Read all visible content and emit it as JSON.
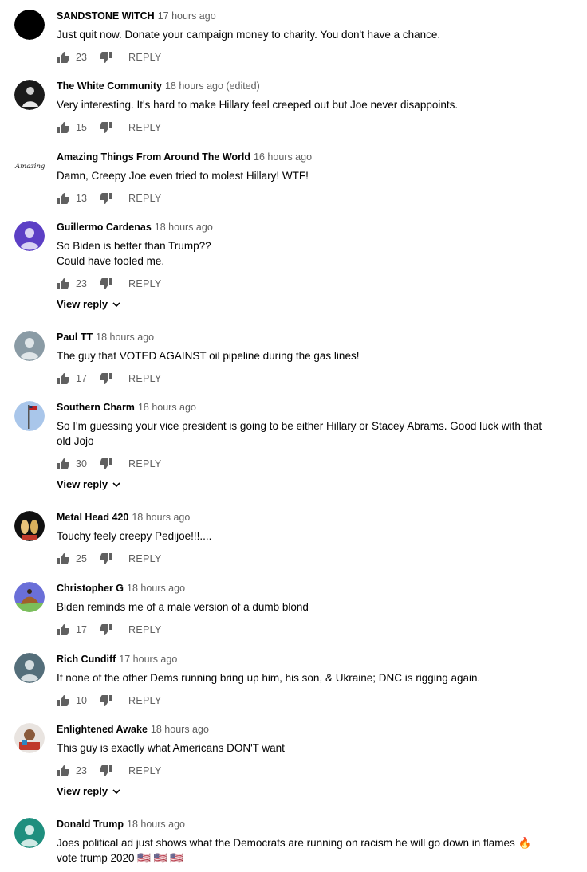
{
  "comments": [
    {
      "author": "SANDSTONE WITCH",
      "time": "17 hours ago",
      "lines": [
        "Just quit now. Donate your campaign money to charity. You don't have a chance."
      ],
      "likes": "23",
      "reply": "REPLY",
      "avatar": "black-avatar"
    },
    {
      "author": "The White Community",
      "time": "18 hours ago (edited)",
      "lines": [
        "Very interesting.  It's hard to make Hillary feel creeped out but Joe never disappoints."
      ],
      "likes": "15",
      "reply": "REPLY",
      "avatar": "photo-avatar"
    },
    {
      "author": "Amazing Things From Around The World",
      "time": "16 hours ago",
      "lines": [
        "Damn, Creepy Joe even tried to molest Hillary! WTF!"
      ],
      "likes": "13",
      "reply": "REPLY",
      "avatar": "script-logo-avatar",
      "avatar_text": "Amazing"
    },
    {
      "author": "Guillermo Cardenas",
      "time": "18 hours ago",
      "lines": [
        "So Biden is better than Trump??",
        "Could have fooled me."
      ],
      "likes": "23",
      "reply": "REPLY",
      "view_reply": "View reply",
      "avatar": "default-purple-avatar"
    },
    {
      "author": "Paul TT",
      "time": "18 hours ago",
      "lines": [
        "The guy that VOTED AGAINST oil pipeline during the gas lines!"
      ],
      "likes": "17",
      "reply": "REPLY",
      "avatar": "default-gray-avatar"
    },
    {
      "author": "Southern Charm",
      "time": "18 hours ago",
      "lines": [
        "So I'm guessing your vice president is going to be either Hillary or Stacey Abrams. Good luck with that",
        "old Jojo"
      ],
      "likes": "30",
      "reply": "REPLY",
      "view_reply": "View reply",
      "avatar": "flag-avatar"
    },
    {
      "author": "Metal Head 420",
      "time": "18 hours ago",
      "lines": [
        "Touchy feely creepy Pedijoe!!!...."
      ],
      "likes": "25",
      "reply": "REPLY",
      "avatar": "cartoon-avatar"
    },
    {
      "author": "Christopher G",
      "time": "18 hours ago",
      "lines": [
        "Biden reminds me of a male version of a dumb blond"
      ],
      "likes": "17",
      "reply": "REPLY",
      "avatar": "desert-avatar"
    },
    {
      "author": "Rich Cundiff",
      "time": "17 hours ago",
      "lines": [
        "If none of the other Dems running bring up him, his son, & Ukraine; DNC is rigging again."
      ],
      "likes": "10",
      "reply": "REPLY",
      "avatar": "default-slate-avatar"
    },
    {
      "author": "Enlightened Awake",
      "time": "18 hours ago",
      "lines": [
        "This guy is exactly what Americans DON'T want"
      ],
      "likes": "23",
      "reply": "REPLY",
      "view_reply": "View reply",
      "avatar": "bitmoji-avatar"
    },
    {
      "author": "Donald Trump",
      "time": "18 hours ago",
      "lines": [
        "Joes political ad just shows what the Democrats are running on racism he will go down in flames 🔥",
        "vote trump 2020 🇺🇸 🇺🇸 🇺🇸"
      ],
      "avatar": "default-teal-avatar"
    }
  ],
  "colors": {
    "author": "#030303",
    "meta": "#606060",
    "icon": "#606060",
    "purple": "#5c3fc5",
    "gray": "#8a9ba5",
    "slate": "#546e7a",
    "teal": "#1e8f7e"
  }
}
